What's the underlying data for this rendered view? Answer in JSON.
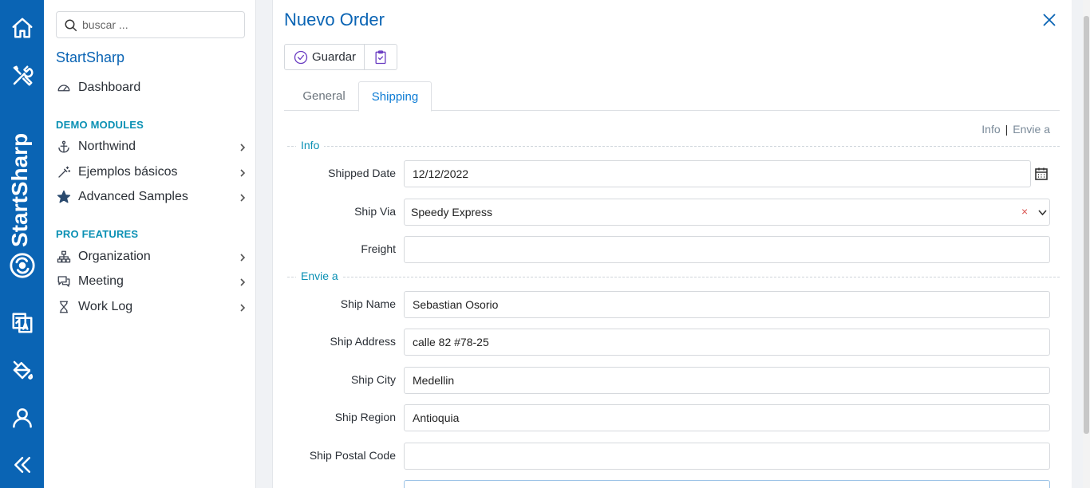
{
  "rail": {
    "brand_text": "StartSharp",
    "icons": [
      "home-icon",
      "tools-icon",
      "translate-icon",
      "paint-bucket-icon",
      "user-icon",
      "collapse-icon"
    ]
  },
  "nav": {
    "search_placeholder": "buscar ...",
    "brand": "StartSharp",
    "dashboard": "Dashboard",
    "section_demo": "DEMO MODULES",
    "northwind": "Northwind",
    "basic_samples": "Ejemplos básicos",
    "advanced_samples": "Advanced Samples",
    "section_pro": "PRO FEATURES",
    "organization": "Organization",
    "meeting": "Meeting",
    "work_log": "Work Log"
  },
  "dialog": {
    "title": "Nuevo Order",
    "save_label": "Guardar",
    "tabs": [
      "General",
      "Shipping"
    ],
    "active_tab": "Shipping",
    "category_links": [
      "Info",
      "Envie a"
    ],
    "info_caption": "Info",
    "envie_caption": "Envie a",
    "fields": {
      "shipped_date": {
        "label": "Shipped Date",
        "value": "12/12/2022"
      },
      "ship_via": {
        "label": "Ship Via",
        "value": "Speedy Express",
        "clear": "×"
      },
      "freight": {
        "label": "Freight",
        "value": ""
      },
      "ship_name": {
        "label": "Ship Name",
        "value": "Sebastian Osorio"
      },
      "ship_address": {
        "label": "Ship Address",
        "value": "calle 82 #78-25"
      },
      "ship_city": {
        "label": "Ship City",
        "value": "Medellin"
      },
      "ship_region": {
        "label": "Ship Region",
        "value": "Antioquia"
      },
      "ship_postal_code": {
        "label": "Ship Postal Code",
        "value": ""
      }
    }
  },
  "colors": {
    "rail": "#0a64b4",
    "accent": "#0a64b4",
    "section": "#0a90b4",
    "save_icon": "#6a3dc2"
  }
}
